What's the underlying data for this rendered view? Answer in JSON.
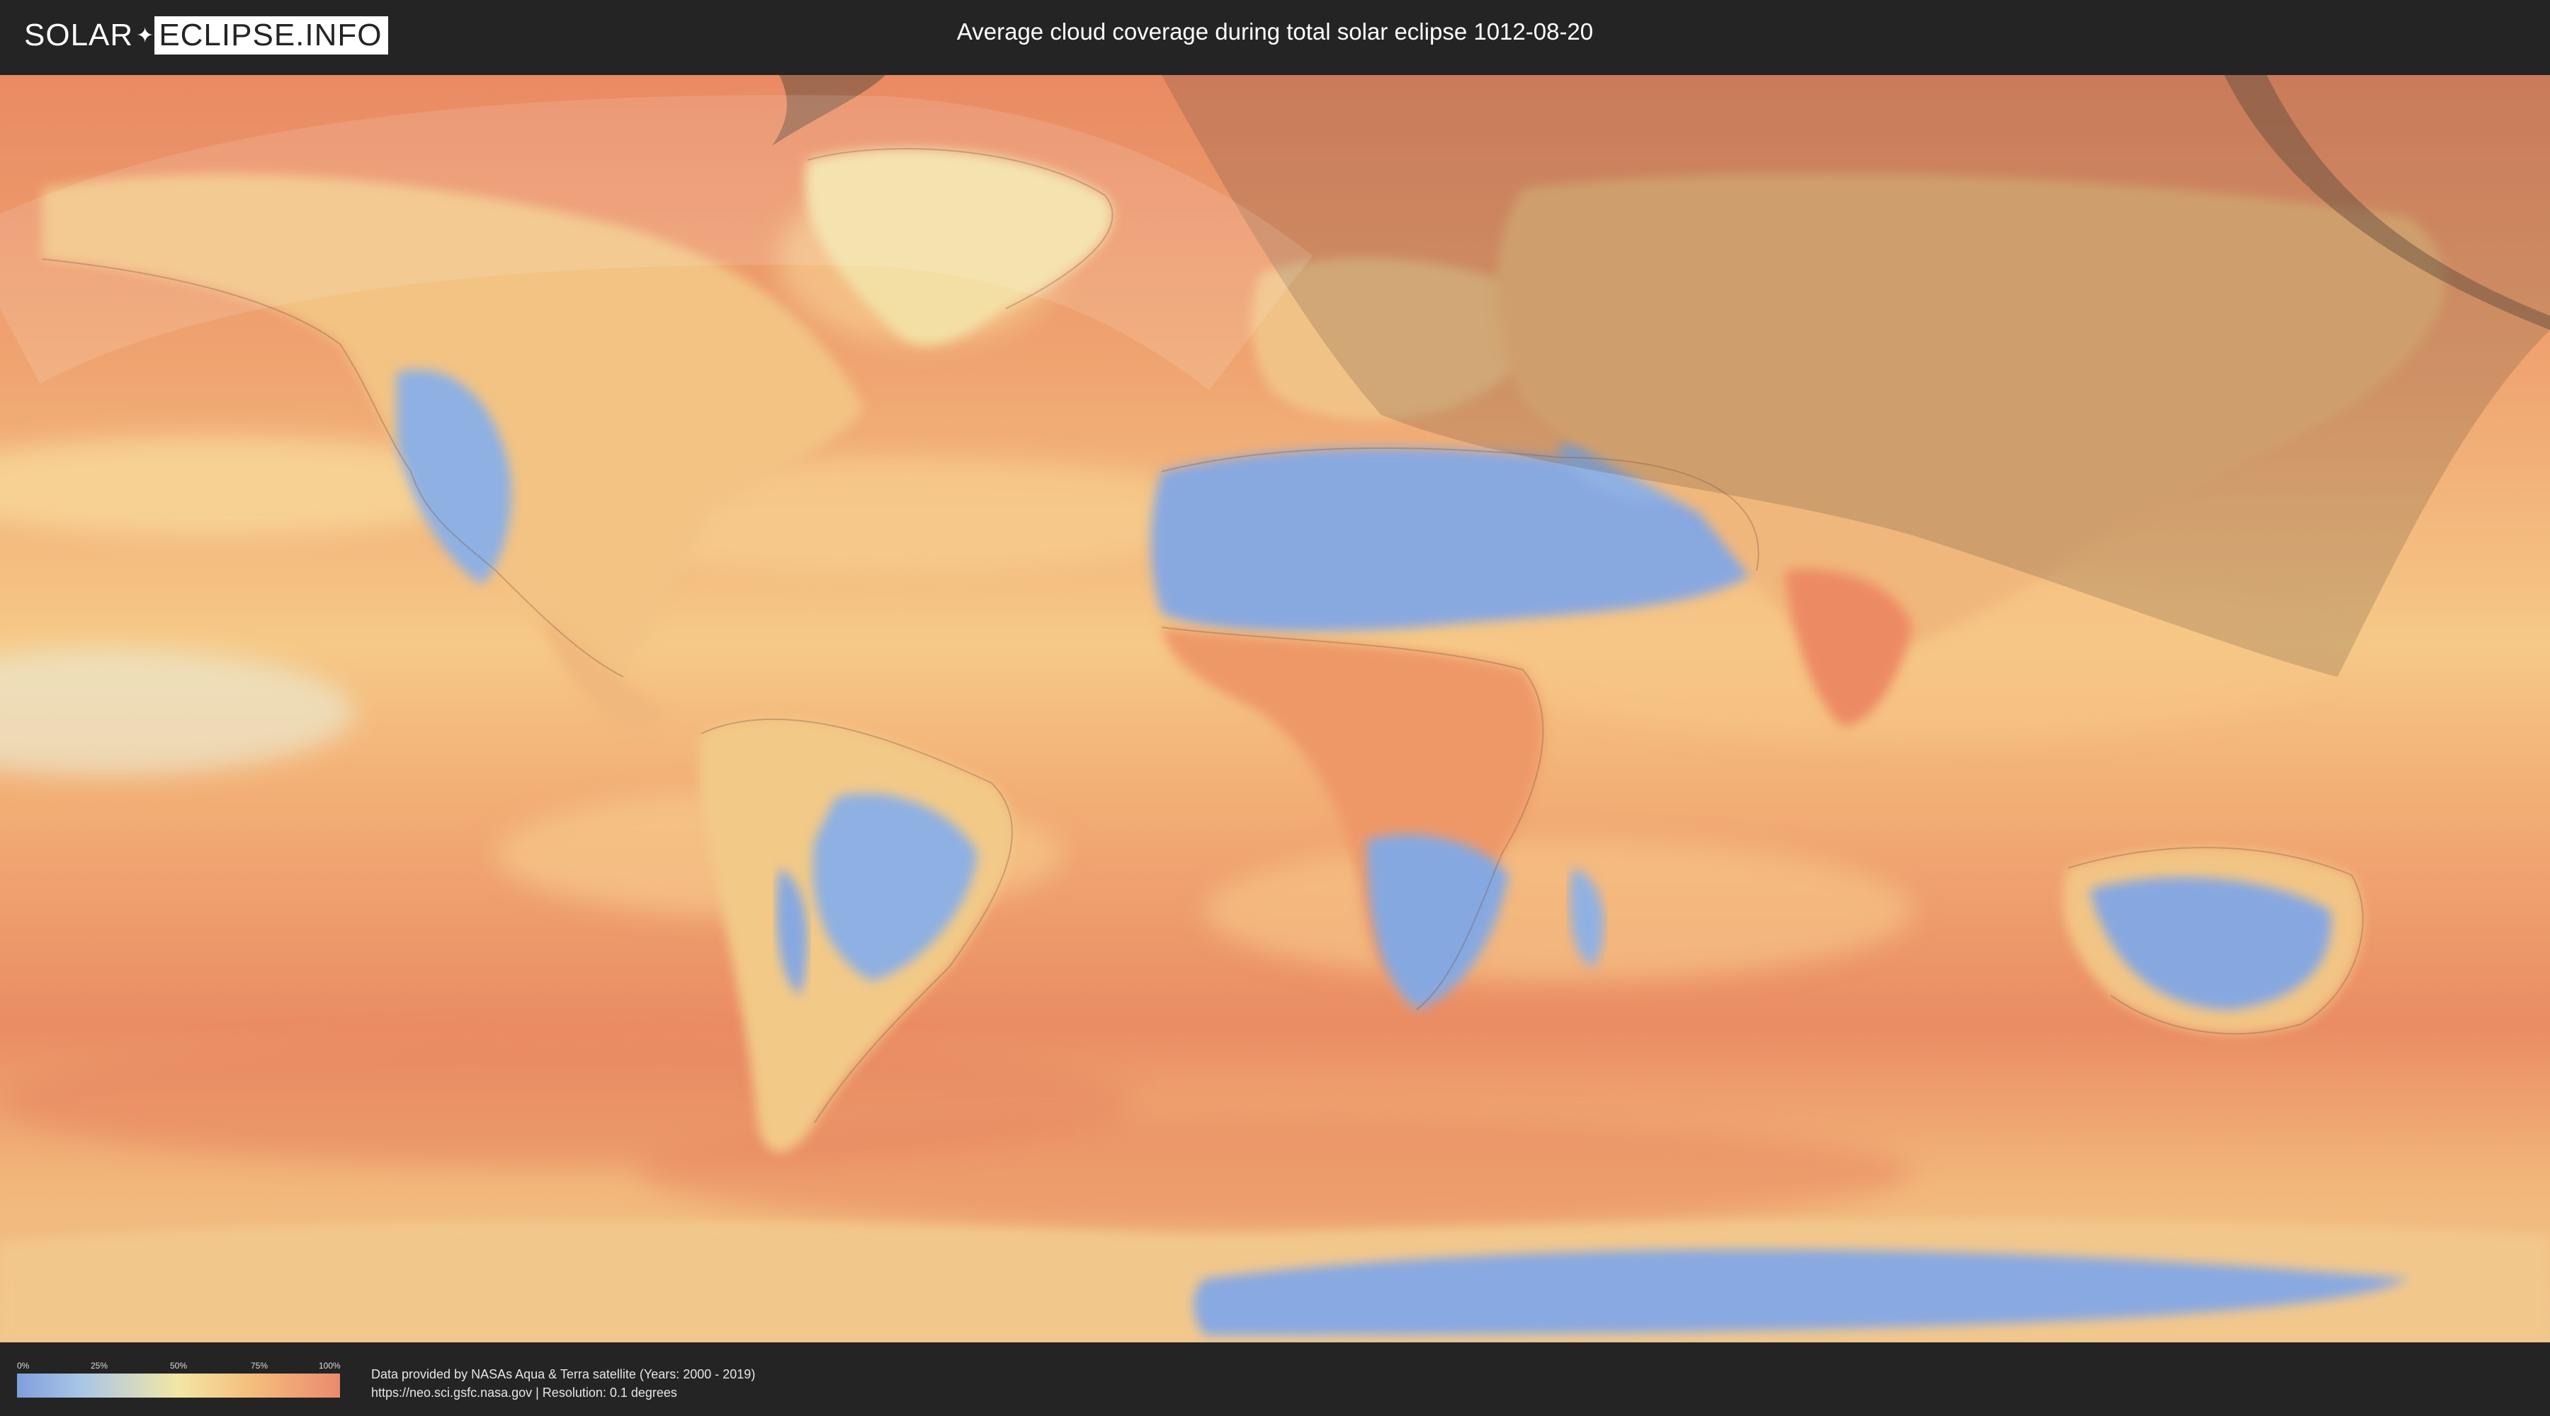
{
  "logo": {
    "part1": "SOLAR",
    "part2": "ECLIPSE.INFO"
  },
  "title": "Average cloud coverage during total solar eclipse 1012-08-20",
  "legend": {
    "ticks": [
      "0%",
      "25%",
      "50%",
      "75%",
      "100%"
    ],
    "colors": [
      "#7f9fdc",
      "#a9c6e6",
      "#f2e6a4",
      "#f4be7c",
      "#ec8a6e"
    ]
  },
  "credits": {
    "line1": "Data provided by NASAs Aqua & Terra satellite (Years: 2000 - 2019)",
    "line2": "https://neo.sci.gsfc.nasa.gov | Resolution: 0.1 degrees"
  },
  "map": {
    "colors": {
      "ocean_cloudy": "#e8875f",
      "ocean_mid": "#f3b877",
      "clear": "#f2e0a2",
      "land_clear": "#86a8e0",
      "shadow": "#5a4a3a"
    }
  }
}
